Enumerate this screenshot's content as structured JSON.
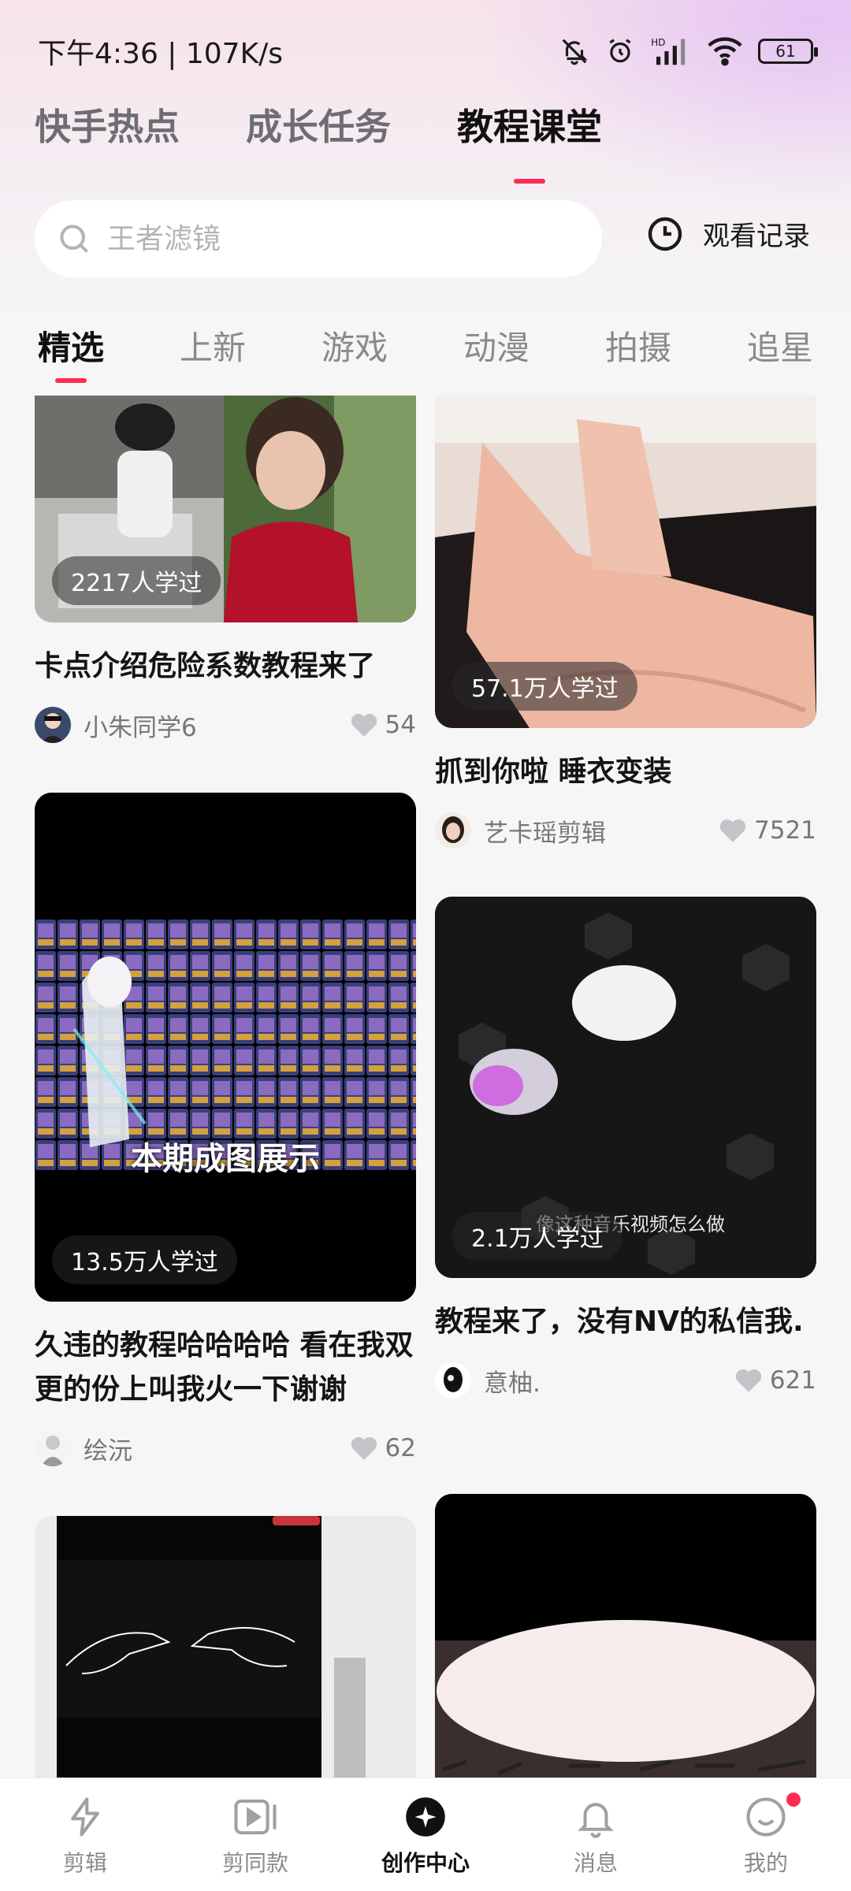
{
  "status_bar": {
    "time": "下午4:36 | 107K/s",
    "battery": "61"
  },
  "main_tabs": [
    {
      "label": "快手热点"
    },
    {
      "label": "成长任务"
    },
    {
      "label": "教程课堂"
    }
  ],
  "search": {
    "placeholder": "王者滤镜",
    "history_label": "观看记录"
  },
  "category_tabs": [
    {
      "label": "精选"
    },
    {
      "label": "上新"
    },
    {
      "label": "游戏"
    },
    {
      "label": "动漫"
    },
    {
      "label": "拍摄"
    },
    {
      "label": "追星"
    }
  ],
  "cards": [
    {
      "learners": "2217人学过",
      "title": "卡点介绍危险系数教程来了",
      "author": "小朱同学6",
      "likes": "54"
    },
    {
      "learners": "57.1万人学过",
      "title": "抓到你啦 睡衣变装",
      "author": "艺卡瑶剪辑",
      "likes": "7521"
    },
    {
      "learners": "13.5万人学过",
      "overlay": "本期成图展示",
      "title": "久违的教程哈哈哈哈 看在我双更的份上叫我火一下谢谢",
      "author": "绘沅",
      "likes": "62"
    },
    {
      "learners": "2.1万人学过",
      "overlay": "像这种音乐视频怎么做",
      "title": "教程来了，没有NV的私信我.",
      "author": "意柚.",
      "likes": "621"
    },
    {},
    {}
  ],
  "bottom_nav": [
    {
      "label": "剪辑"
    },
    {
      "label": "剪同款"
    },
    {
      "label": "创作中心"
    },
    {
      "label": "消息"
    },
    {
      "label": "我的"
    }
  ],
  "colors": {
    "accent": "#fe2c55",
    "text_primary": "#111111",
    "text_secondary": "#8a8a8e"
  }
}
